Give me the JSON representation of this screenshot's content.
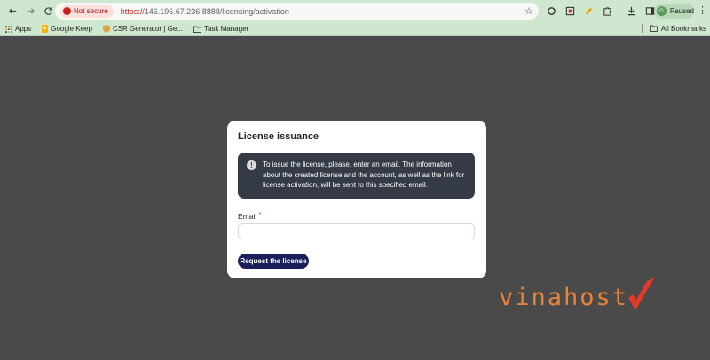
{
  "browser": {
    "security_chip": "Not secure",
    "url_scheme": "https://",
    "url_rest": "146.196.67.236:8888/licensing/activation",
    "profile_initial": "G",
    "profile_status": "Paused"
  },
  "bookmarks": {
    "items": [
      "Apps",
      "Google Keep",
      "CSR Generator | Ge...",
      "Task Manager"
    ],
    "all_bookmarks": "All Bookmarks"
  },
  "card": {
    "title": "License issuance",
    "alert_icon": "!",
    "alert_text": "To issue the license, please, enter an email. The information about the created license and the account, as well as the link for license activation, will be sent to this specified email.",
    "email_label": "Email",
    "required_mark": "*",
    "email_value": "",
    "submit_label": "Request the license"
  },
  "watermark": {
    "brand": "vinahost",
    "colors": {
      "text": "#e8823a",
      "check": "#e23a2a"
    }
  },
  "colors": {
    "chrome_bg": "#cfe6cf",
    "page_bg": "#4a4a4a",
    "alert_bg": "#353b46",
    "button_bg": "#1a1f5a"
  }
}
